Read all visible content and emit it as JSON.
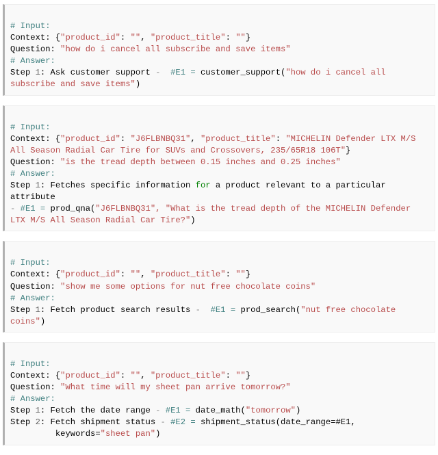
{
  "labels": {
    "input_comment": "# Input:",
    "answer_comment": "# Answer:",
    "context_label": "Context",
    "question_label": "Question",
    "step_prefix": "Step"
  },
  "blocks": [
    {
      "context_json": "{\"product_id\": \"\", \"product_title\": \"\"}",
      "context_parts": {
        "pid_key": "\"product_id\"",
        "pid_val": "\"\"",
        "pt_key": "\"product_title\"",
        "pt_val": "\"\""
      },
      "question": "\"how do i cancel all subscribe and save items\"",
      "steps": [
        {
          "num": "1",
          "action_pre": "Ask customer support",
          "sep": " -  ",
          "eq": "#E1 = customer_support(\"how do i cancel all subscribe and save items\")",
          "eq_func": "customer_support",
          "eq_tag": "#E1 = ",
          "eq_open": "(",
          "eq_arg": "\"how do i cancel all subscribe and save items\"",
          "eq_close": ")"
        }
      ]
    },
    {
      "context_parts": {
        "pid_key": "\"product_id\"",
        "pid_val": "\"J6FLBNBQ31\"",
        "pt_key": "\"product_title\"",
        "pt_val": "\"MICHELIN Defender LTX M/S All Season Radial Car Tire for SUVs and Crossovers, 235/65R18 106T\""
      },
      "question": "\"is the tread depth between 0.15 inches and 0.25 inches\"",
      "steps": [
        {
          "num": "1",
          "action_pre": "Fetches specific information for a product relevant to a particular attribute",
          "action_tokens": [
            {
              "t": "Fetches specific information ",
              "c": "c-step"
            },
            {
              "t": "for",
              "c": "c-green"
            },
            {
              "t": " a product relevant to a particular attribute",
              "c": "c-step"
            }
          ],
          "sep_nl": "- ",
          "eq_tag": "#E1 = ",
          "eq_func": "prod_qna",
          "eq_open": "(",
          "eq_arg": "\"J6FLBNBQ31\", \"What is the tread depth of the MICHELIN Defender LTX M/S All Season Radial Car Tire?\"",
          "eq_close": ")"
        }
      ]
    },
    {
      "context_parts": {
        "pid_key": "\"product_id\"",
        "pid_val": "\"\"",
        "pt_key": "\"product_title\"",
        "pt_val": "\"\""
      },
      "question": "\"show me some options for nut free chocolate coins\"",
      "steps": [
        {
          "num": "1",
          "action_pre": "Fetch product search results",
          "sep": " -  ",
          "eq_tag": "#E1 = ",
          "eq_func": "prod_search",
          "eq_open": "(",
          "eq_arg": "\"nut free chocolate coins\"",
          "eq_close": ")"
        }
      ]
    },
    {
      "context_parts": {
        "pid_key": "\"product_id\"",
        "pid_val": "\"\"",
        "pt_key": "\"product_title\"",
        "pt_val": "\"\""
      },
      "question": "\"What time will my sheet pan arrive tomorrow?\"",
      "steps": [
        {
          "num": "1",
          "action_pre": "Fetch the date range",
          "sep": " - ",
          "eq_tag": "#E1 = ",
          "eq_func": "date_math",
          "eq_open": "(",
          "eq_arg": "\"tomorrow\"",
          "eq_close": ")"
        },
        {
          "num": "2",
          "action_pre": "Fetch shipment status",
          "sep": " - ",
          "eq_tag": "#E2 = ",
          "eq_func": "shipment_status",
          "eq_open": "(",
          "eq_raw": "date_range=#E1,\n         keywords=",
          "eq_arg": "\"sheet pan\"",
          "eq_close": ")"
        }
      ]
    }
  ]
}
